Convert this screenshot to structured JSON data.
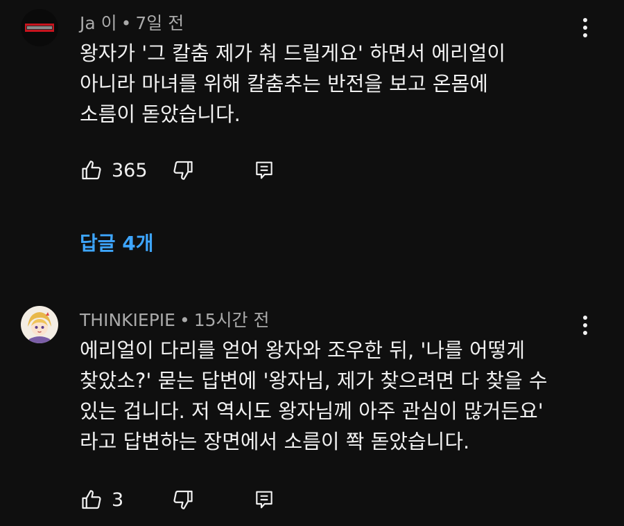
{
  "comments": [
    {
      "author": "Ja 이",
      "separator": "•",
      "time": "7일 전",
      "lines": [
        "왕자가 '그 칼춤 제가 춰 드릴게요' 하면서 에리얼이",
        "아니라 마녀를 위해 칼춤추는 반전을 보고 온몸에",
        "소름이 돋았습니다."
      ],
      "likes": "365",
      "replies_label": "답글 4개"
    },
    {
      "author": "THINKIEPIE",
      "separator": "•",
      "time": "15시간 전",
      "lines": [
        "에리얼이 다리를 얻어 왕자와 조우한 뒤, '나를 어떻게",
        "찾았소?' 묻는 답변에 '왕자님, 제가 찾으려면 다 찾을 수",
        "있는 겁니다. 저 역시도 왕자님께 아주 관심이 많거든요'",
        "라고 답변하는 장면에서 소름이 쫙 돋았습니다."
      ],
      "likes": "3"
    }
  ],
  "icons": {
    "like": "thumbs-up-icon",
    "dislike": "thumbs-down-icon",
    "reply": "reply-icon",
    "more": "more-vertical-icon"
  },
  "colors": {
    "background": "#0f0f0f",
    "text": "#f1f1f1",
    "meta": "#aaaaaa",
    "link": "#3ea6ff"
  }
}
